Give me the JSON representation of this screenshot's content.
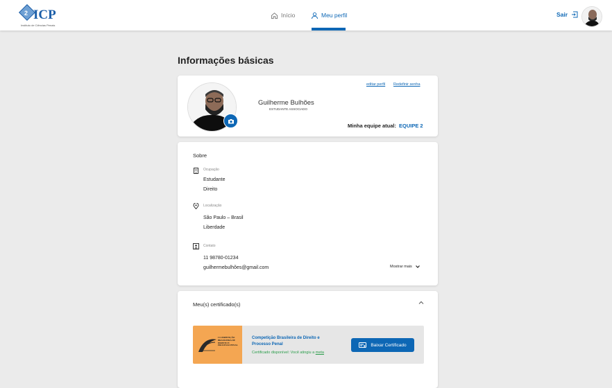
{
  "header": {
    "logo_text": "ICP",
    "logo_subtitle": "Instituto de Ciências Penais",
    "nav": [
      {
        "label": "Início",
        "icon": "home-icon"
      },
      {
        "label": "Meu perfil",
        "icon": "user-icon"
      }
    ],
    "logout_label": "Sair"
  },
  "page": {
    "title": "Informações básicas"
  },
  "profile": {
    "name": "Guilherme Bulhões",
    "role": "ESTUDANTE ASSOCIADO",
    "edit_link": "editar perfil",
    "reset_link": "Redefinir senha",
    "team_label": "Minha equipe atual:",
    "team_value": "EQUIPE 2"
  },
  "about": {
    "title": "Sobre",
    "occupation": {
      "label": "Ocupação",
      "lines": [
        "Estudante",
        "Direito"
      ]
    },
    "location": {
      "label": "Localização",
      "lines": [
        "São Paulo – Brasil",
        "Liberdade"
      ]
    },
    "contact": {
      "label": "Contato",
      "lines": [
        "11 98780-01234",
        "guilhermebulhões@gmail.com"
      ]
    },
    "show_more": "Mostrar mais"
  },
  "certificates": {
    "title": "Meu(s) certificado(s)",
    "items": [
      {
        "thumb_title": "I COMPETIÇÃO BRASILEIRA DE DIREITO E PROCESSO PENAL",
        "name": "Competição Brasileira de Direito e Processo Penal",
        "status": "Certificado disponível: Você atingiu a",
        "status_link": "meta",
        "button": "Baixar Certificado"
      }
    ]
  },
  "colors": {
    "accent": "#0d67b5",
    "success": "#2a9d4a",
    "cert_thumb": "#f4a652",
    "background": "#ebebeb"
  }
}
